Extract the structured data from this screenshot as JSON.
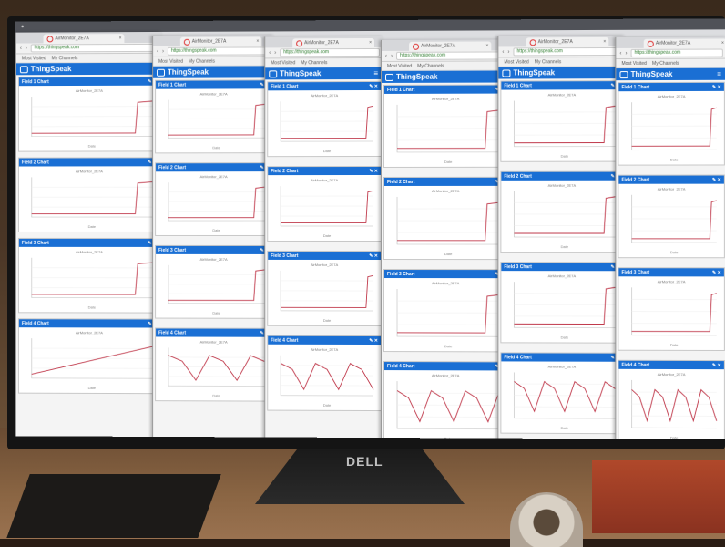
{
  "app_name": "ThingSpeak",
  "tab_title": "AirMonitor_2E7A",
  "address_url": "https://thingspeak.com",
  "bookmarks": [
    "Most Visited",
    "My Channels"
  ],
  "field_titles": [
    "Field 1 Chart",
    "Field 2 Chart",
    "Field 3 Chart",
    "Field 4 Chart"
  ],
  "chart_title": "AirMonitor_2E7A",
  "axis_label": "Date",
  "brand": "DELL",
  "colors": {
    "accent": "#1a6fd4",
    "line": "#c0394b",
    "page": "#f4f4f4"
  },
  "chart_shapes": [
    "flat-spike",
    "flat-spike",
    "flat-spike",
    "rising"
  ]
}
